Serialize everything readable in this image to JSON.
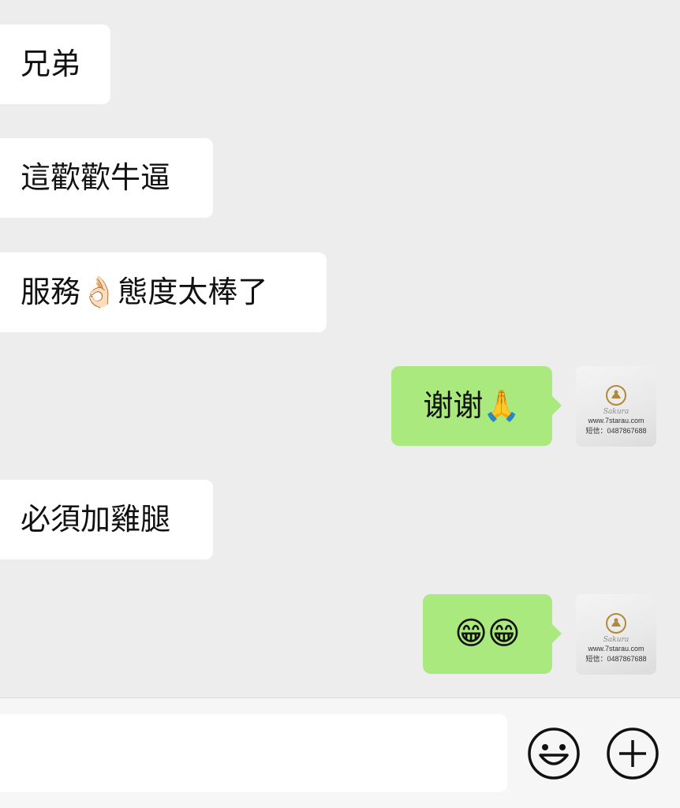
{
  "messages": [
    {
      "side": "incoming",
      "text": "兄弟"
    },
    {
      "side": "incoming",
      "text": "這歡歡牛逼"
    },
    {
      "side": "incoming",
      "text": "服務👌🏻態度太棒了"
    },
    {
      "side": "outgoing",
      "text": "谢谢🙏"
    },
    {
      "side": "incoming",
      "text": "必須加雞腿"
    },
    {
      "side": "outgoing",
      "text": "😁😁"
    }
  ],
  "avatar": {
    "script_text": "Sakura",
    "website": "www.7starau.com",
    "phone": "短信：0487867688"
  },
  "input_bar": {
    "placeholder": "",
    "emoji_icon": "smiley-face-icon",
    "plus_icon": "plus-circle-icon"
  },
  "colors": {
    "background": "#ededed",
    "incoming_bubble": "#ffffff",
    "outgoing_bubble": "#a9e97d"
  }
}
